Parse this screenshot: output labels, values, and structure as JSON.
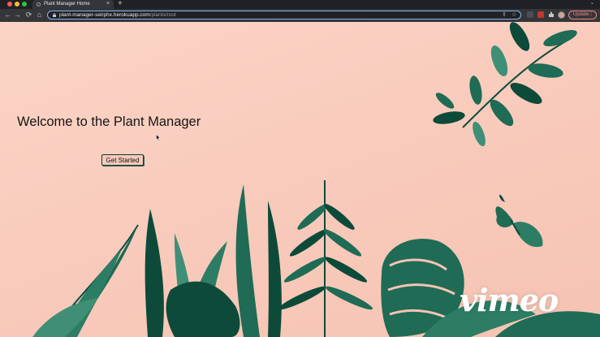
{
  "browser": {
    "tab_title": "Plant Manager Home",
    "new_tab": "+",
    "tab_close": "×",
    "tab_menu": "⌄",
    "url_host": "plant-manager-seirphx.herokuapp.com",
    "url_path": "/plants/root",
    "update_label": "Update",
    "update_dots": "⋮",
    "nav": {
      "back": "←",
      "forward": "→",
      "reload": "⟳",
      "home": "⌂"
    },
    "omni_icons": {
      "share": "⇪",
      "bookmark": "☆"
    },
    "icons": [
      "back-arrow-icon",
      "forward-arrow-icon",
      "reload-icon",
      "home-icon",
      "lock-icon",
      "share-icon",
      "star-icon",
      "extensions-puzzle-icon"
    ],
    "colors": {
      "chrome_dark": "#202124",
      "chrome_toolbar": "#35363a",
      "omnibox_focus": "#8ab4f8",
      "update": "#f28b82"
    }
  },
  "page": {
    "heading": "Welcome to the Plant Manager",
    "button_label": "Get Started",
    "watermark": "vimeo",
    "colors": {
      "background": "#f9cdbf",
      "leaf_dark": "#0d4a3a",
      "leaf_mid": "#1f6b55",
      "leaf_light": "#3f8f77"
    }
  }
}
